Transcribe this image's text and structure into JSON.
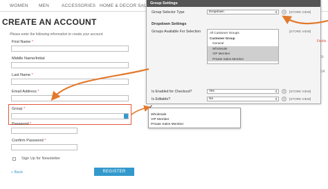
{
  "nav": {
    "items": [
      "WOMEN",
      "MEN",
      "ACCESSORIES",
      "HOME & DECOR",
      "SALE"
    ]
  },
  "page": {
    "title": "CREATE AN ACCOUNT",
    "intro": "Please enter the following information to create your account."
  },
  "form": {
    "first_name": "First Name",
    "middle_name": "Middle Name/Initial",
    "last_name": "Last Name",
    "email": "Email Address",
    "group": "Group",
    "password": "Password",
    "confirm_password": "Confirm Password",
    "newsletter": "Sign Up for Newsletter",
    "back": "« Back",
    "register": "REGISTER",
    "required_mark": "*"
  },
  "panel": {
    "title": "Group Settings",
    "selector_label": "Group Selector Type",
    "selector_value": "Dropdown",
    "section": "Dropdown Settings",
    "available_label": "Groups Available For Selection",
    "groups": [
      {
        "label": "All Customer Groups",
        "style": "plain"
      },
      {
        "label": "Customer Group",
        "style": "bold"
      },
      {
        "label": "General",
        "style": "indent"
      },
      {
        "label": "Wholesale",
        "style": "indent-selected"
      },
      {
        "label": "VIP Member",
        "style": "indent-selected"
      },
      {
        "label": "Private Sales Member",
        "style": "indent-selected"
      }
    ],
    "checkout_label": "Is Enabled for Checkout?",
    "checkout_value": "Yes",
    "editable_label": "Is Editable?",
    "editable_value": "No",
    "store_view": "[STORE VIEW]",
    "help": "?"
  },
  "dropdown": {
    "check": "✓",
    "items": [
      "Wholesale",
      "VIP Member",
      "Private Sales Member"
    ]
  },
  "side": {
    "fields": "Fields",
    "st": "St",
    "sa": "SA"
  },
  "colors": {
    "accent": "#e0543a",
    "brand": "#3399cc",
    "arrow": "#e3792c"
  }
}
